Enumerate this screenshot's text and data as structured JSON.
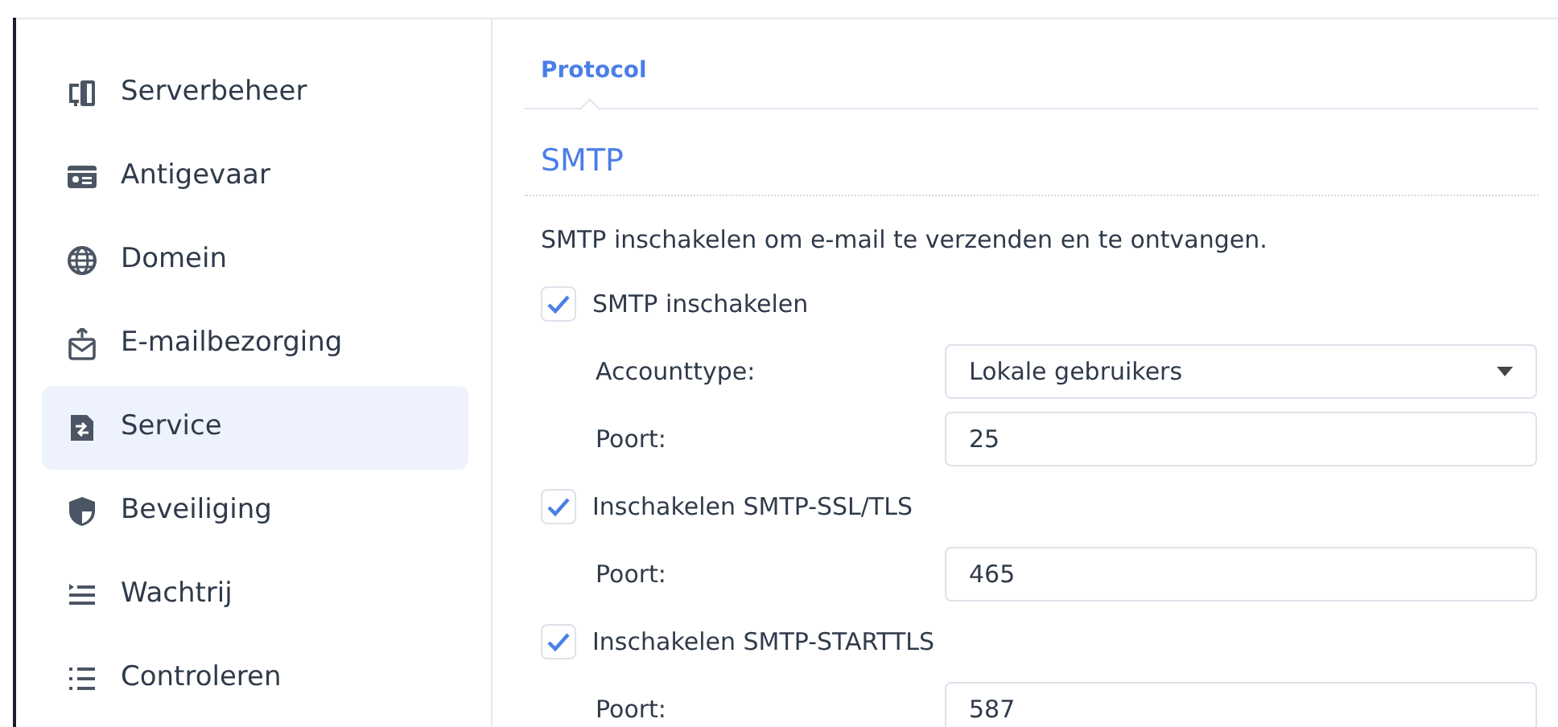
{
  "sidebar": {
    "items": [
      {
        "label": "Serverbeheer",
        "selected": false
      },
      {
        "label": "Antigevaar",
        "selected": false
      },
      {
        "label": "Domein",
        "selected": false
      },
      {
        "label": "E-mailbezorging",
        "selected": false
      },
      {
        "label": "Service",
        "selected": true
      },
      {
        "label": "Beveiliging",
        "selected": false
      },
      {
        "label": "Wachtrij",
        "selected": false
      },
      {
        "label": "Controleren",
        "selected": false
      }
    ]
  },
  "tabs": [
    {
      "label": "Protocol",
      "selected": true
    }
  ],
  "section": {
    "title": "SMTP",
    "description": "SMTP inschakelen om e-mail te verzenden en te ontvangen."
  },
  "form": [
    {
      "kind": "checkbox",
      "label": "SMTP inschakelen",
      "checked": true
    },
    {
      "kind": "select",
      "label": "Accounttype:",
      "value": "Lokale gebruikers"
    },
    {
      "kind": "input",
      "label": "Poort:",
      "value": "25"
    },
    {
      "kind": "checkbox",
      "label": "Inschakelen SMTP-SSL/TLS",
      "checked": true
    },
    {
      "kind": "input",
      "label": "Poort:",
      "value": "465"
    },
    {
      "kind": "checkbox",
      "label": "Inschakelen SMTP-STARTTLS",
      "checked": true
    },
    {
      "kind": "input",
      "label": "Poort:",
      "value": "587"
    }
  ]
}
